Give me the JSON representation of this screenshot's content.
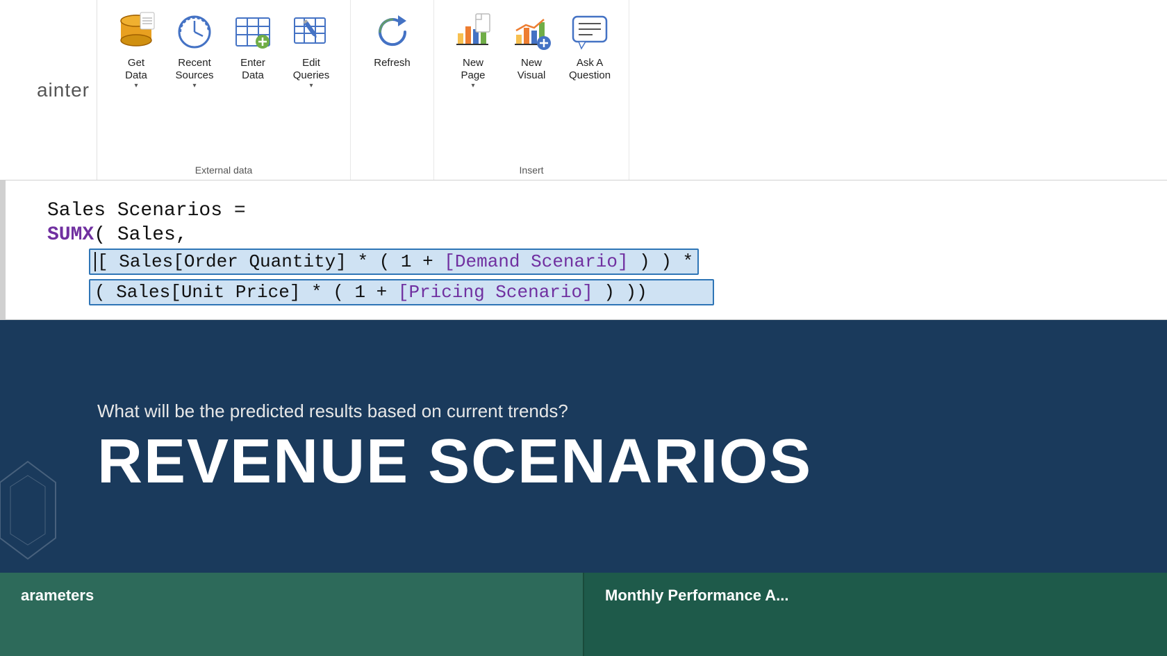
{
  "ribbon": {
    "left_label": "ainter",
    "groups": [
      {
        "name": "external-data",
        "label": "External data",
        "buttons": [
          {
            "id": "get-data",
            "label": "Get\nData",
            "has_dropdown": true,
            "icon": "database"
          },
          {
            "id": "recent-sources",
            "label": "Recent\nSources",
            "has_dropdown": true,
            "icon": "clock"
          },
          {
            "id": "enter-data",
            "label": "Enter\nData",
            "has_dropdown": false,
            "icon": "table-plus"
          },
          {
            "id": "edit-queries",
            "label": "Edit\nQueries",
            "has_dropdown": true,
            "icon": "pencil-table"
          }
        ]
      },
      {
        "name": "refresh",
        "label": "",
        "buttons": [
          {
            "id": "refresh",
            "label": "Refresh",
            "has_dropdown": false,
            "icon": "refresh"
          }
        ]
      },
      {
        "name": "insert",
        "label": "Insert",
        "buttons": [
          {
            "id": "new-page",
            "label": "New\nPage",
            "has_dropdown": true,
            "icon": "new-page"
          },
          {
            "id": "new-visual",
            "label": "New\nVisual",
            "has_dropdown": false,
            "icon": "bar-chart"
          },
          {
            "id": "ask-question",
            "label": "Ask A\nQuestion",
            "has_dropdown": false,
            "icon": "speech-bubble"
          }
        ]
      }
    ]
  },
  "code_editor": {
    "lines": [
      {
        "type": "normal",
        "content": "Sales Scenarios ="
      },
      {
        "type": "keyword-call",
        "keyword": "SUMX",
        "rest": "( Sales,"
      },
      {
        "type": "selected-1",
        "content": "[ Sales[Order Quantity] * ( 1 + [Demand Scenario] ) ) *"
      },
      {
        "type": "selected-2",
        "content": "( Sales[Unit Price] * ( 1 + [Pricing Scenario] ) ))"
      }
    ],
    "line1": "Sales Scenarios =",
    "line2_keyword": "SUMX",
    "line2_rest": "( Sales,",
    "line3_pre": "[",
    "line3_normal": " Sales[Order Quantity] * ( 1 + ",
    "line3_field": "[Demand Scenario]",
    "line3_post": " ) ) *",
    "line4_pre": "( Sales[Unit Price] * ( 1 + ",
    "line4_field": "[Pricing Scenario]",
    "line4_post": " ) ))"
  },
  "banner": {
    "subtitle": "What will be the predicted results based on current trends?",
    "title": "REVENUE SCENARIOS"
  },
  "bottom_cards": [
    {
      "label": "arameters"
    },
    {
      "label": "Monthly Performance A..."
    }
  ]
}
